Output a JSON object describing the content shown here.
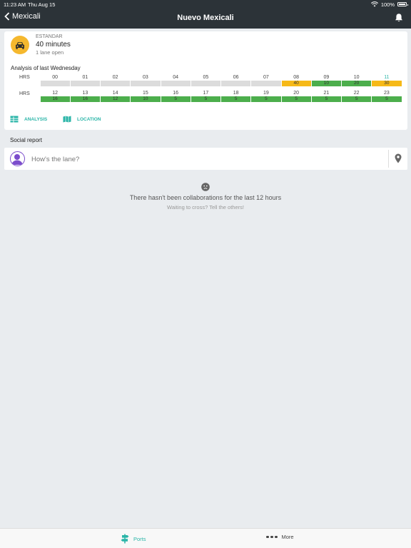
{
  "status_bar": {
    "time": "11:23 AM",
    "date": "Thu Aug 15",
    "battery": "100%"
  },
  "nav": {
    "back_label": "Mexicali",
    "title": "Nuevo Mexicali"
  },
  "lane": {
    "type": "ESTANDAR",
    "wait": "40 minutes",
    "lanes_open": "1 lane open"
  },
  "analysis": {
    "title": "Analysis of last Wednesday",
    "row_label": "HRS",
    "current_hour": "11",
    "rows": [
      {
        "hours": [
          "00",
          "01",
          "02",
          "03",
          "04",
          "05",
          "06",
          "07",
          "08",
          "09",
          "10",
          "11"
        ],
        "values": [
          "",
          "",
          "",
          "",
          "",
          "",
          "",
          "",
          "40",
          "10",
          "20",
          "30"
        ],
        "levels": [
          "gray",
          "gray",
          "gray",
          "gray",
          "gray",
          "gray",
          "gray",
          "gray",
          "yellow",
          "green",
          "green",
          "yellow"
        ]
      },
      {
        "hours": [
          "12",
          "13",
          "14",
          "15",
          "16",
          "17",
          "18",
          "19",
          "20",
          "21",
          "22",
          "23"
        ],
        "values": [
          "16",
          "16",
          "12",
          "10",
          "5",
          "5",
          "5",
          "5",
          "5",
          "5",
          "5",
          "5"
        ],
        "levels": [
          "green",
          "green",
          "green",
          "green",
          "green",
          "green",
          "green",
          "green",
          "green",
          "green",
          "green",
          "green"
        ]
      }
    ],
    "tabs": {
      "analysis": "ANALYSIS",
      "location": "LOCATION"
    }
  },
  "social": {
    "title": "Social report",
    "placeholder": "How's the lane?",
    "empty_title": "There hasn't been collaborations for the last 12 hours",
    "empty_subtitle": "Waiting to cross? Tell the others!"
  },
  "tabbar": {
    "ports": "Ports",
    "more": "More"
  },
  "colors": {
    "accent": "#2bb5a8",
    "bar_dark": "#2c3338",
    "level_yellow": "#f6b918",
    "level_green": "#4cae4c",
    "level_none": "#dcdcdc",
    "lane_icon": "#f5b82e"
  },
  "icons": [
    "back-chevron-icon",
    "bell-icon",
    "car-icon",
    "table-icon",
    "map-icon",
    "location-pin-icon",
    "sad-face-icon",
    "signpost-icon",
    "more-dots-icon",
    "wifi-icon",
    "battery-icon"
  ]
}
